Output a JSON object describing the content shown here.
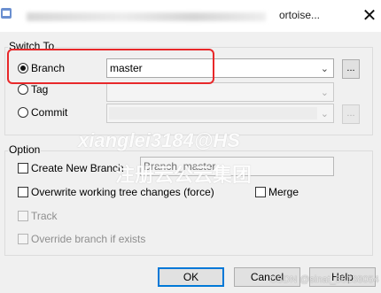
{
  "window": {
    "title_partial": "ortoise...",
    "close": "✕"
  },
  "switch_to": {
    "title": "Switch To",
    "branch": {
      "label": "Branch",
      "value": "master",
      "browse": "..."
    },
    "tag": {
      "label": "Tag",
      "browse": ""
    },
    "commit": {
      "label": "Commit",
      "browse": "..."
    }
  },
  "option": {
    "title": "Option",
    "create_new_branch": {
      "label": "Create New Branch",
      "value": "Branch_master"
    },
    "overwrite": {
      "label": "Overwrite working tree changes (force)"
    },
    "merge": {
      "label": "Merge"
    },
    "track": {
      "label": "Track"
    },
    "override": {
      "label": "Override branch if exists"
    }
  },
  "buttons": {
    "ok": "OK",
    "cancel": "Cancel",
    "help": "Help"
  },
  "watermark": {
    "line1": "xianglei3184@HS",
    "line2": "注册云公云集团",
    "csdn": "CSDN @sinat_38138054"
  },
  "icons": {
    "arrow": "⌄",
    "radio": "radio-icon",
    "check": "checkbox-icon"
  },
  "colors": {
    "highlight": "#e8282a",
    "default_button": "#0078d7"
  }
}
